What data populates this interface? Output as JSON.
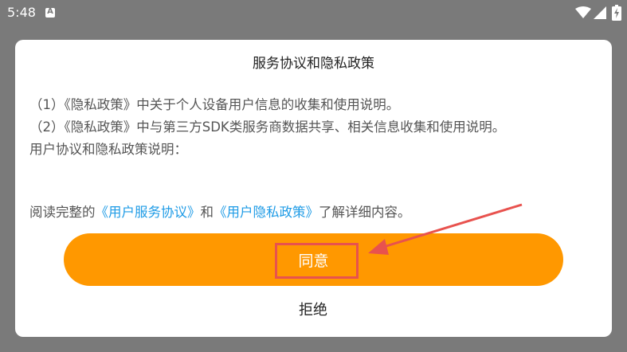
{
  "status_bar": {
    "time": "5:48",
    "notification_icon": "a-letter-icon",
    "notification_label": "A",
    "icons": [
      "wifi-icon",
      "signal-icon",
      "battery-charging-icon"
    ]
  },
  "dialog": {
    "title": "服务协议和隐私政策",
    "body": {
      "item1": "（1）《隐私政策》中关于个人设备用户信息的收集和使用说明。",
      "item2": "（2）《隐私政策》中与第三方SDK类服务商数据共享、相关信息收集和使用说明。",
      "note": "用户协议和隐私政策说明："
    },
    "read_prefix": "阅读完整的",
    "service_link": "《用户服务协议》",
    "and_text": "和",
    "privacy_link": "《用户隐私政策》",
    "read_suffix": "了解详细内容。",
    "agree_label": "同意",
    "reject_label": "拒绝"
  },
  "colors": {
    "overlay": "#7a7a7a",
    "accent": "#ff9800",
    "link": "#1e9be6",
    "annotation": "#e8524e"
  }
}
